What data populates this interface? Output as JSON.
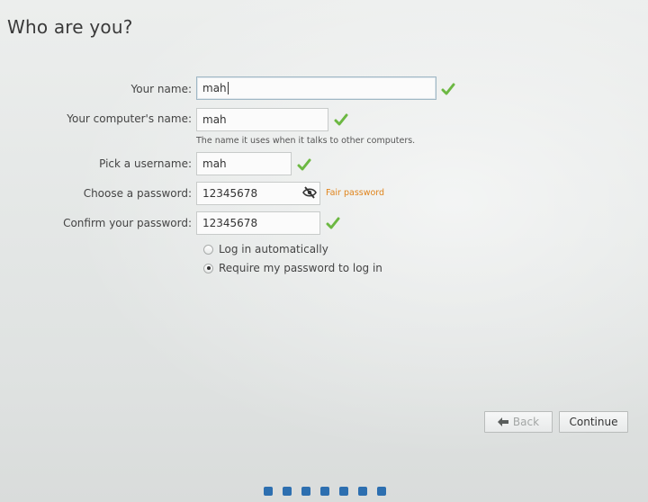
{
  "page": {
    "title": "Who are you?"
  },
  "form": {
    "name": {
      "label": "Your name:",
      "value": "mah"
    },
    "computer_name": {
      "label": "Your computer's name:",
      "value": "mah",
      "hint": "The name it uses when it talks to other computers."
    },
    "username": {
      "label": "Pick a username:",
      "value": "mah"
    },
    "password": {
      "label": "Choose a password:",
      "value": "12345678",
      "strength": "Fair password",
      "strength_color": "#e0841c"
    },
    "confirm_password": {
      "label": "Confirm your password:",
      "value": "12345678"
    },
    "login_options": [
      {
        "label": "Log in automatically",
        "selected": false
      },
      {
        "label": "Require my password to log in",
        "selected": true
      }
    ]
  },
  "buttons": {
    "back_label": "Back",
    "continue_label": "Continue"
  },
  "progress": {
    "step_count": 7,
    "dot_color": "#2d6fb0"
  },
  "icons": {
    "valid": "checkmark-icon",
    "password_visibility": "eye-slash-icon",
    "back": "arrow-left-icon"
  }
}
